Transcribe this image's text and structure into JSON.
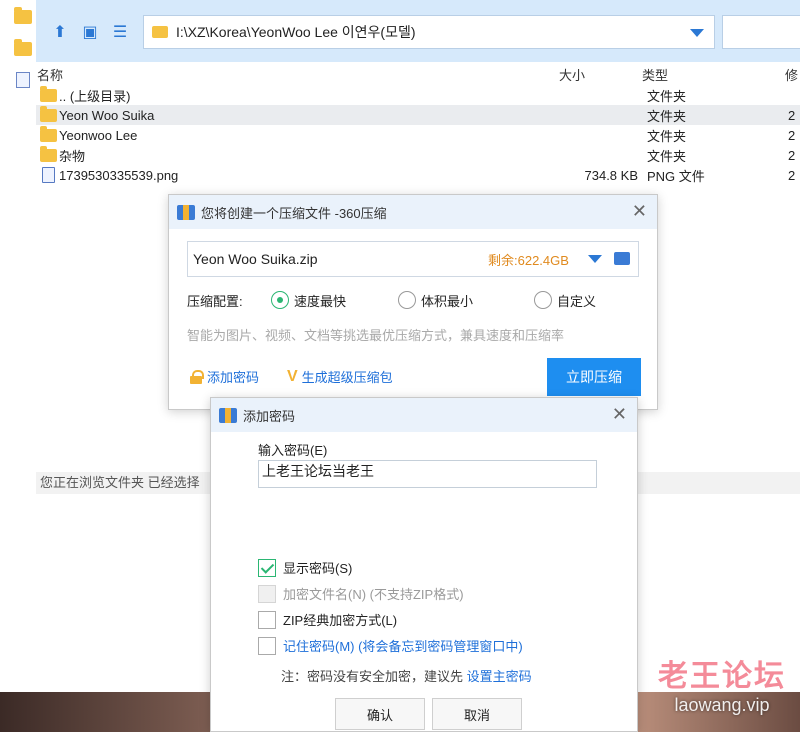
{
  "explorer": {
    "address_path": "I:\\XZ\\Korea\\YeonWoo Lee 이연우(모델)",
    "columns": {
      "name": "名称",
      "size": "大小",
      "type": "类型",
      "modified": "修"
    },
    "rows": [
      {
        "name": ".. (上级目录)",
        "size": "",
        "type": "文件夹",
        "mod": "",
        "icon": "folder-icon"
      },
      {
        "name": "Yeon Woo Suika",
        "size": "",
        "type": "文件夹",
        "mod": "2",
        "icon": "folder-icon",
        "selected": true
      },
      {
        "name": "Yeonwoo Lee",
        "size": "",
        "type": "文件夹",
        "mod": "2",
        "icon": "folder-icon"
      },
      {
        "name": "杂物",
        "size": "",
        "type": "文件夹",
        "mod": "2",
        "icon": "folder-icon"
      },
      {
        "name": "1739530335539.png",
        "size": "734.8 KB",
        "type": "PNG 文件",
        "mod": "2",
        "icon": "png-file-icon"
      }
    ],
    "status": "您正在浏览文件夹 已经选择"
  },
  "compress_dialog": {
    "title": "您将创建一个压缩文件 -360压缩",
    "filename": "Yeon Woo Suika.zip",
    "remaining": "剩余:622.4GB",
    "config_label": "压缩配置:",
    "options": [
      "速度最快",
      "体积最小",
      "自定义"
    ],
    "selected_option": "速度最快",
    "hint": "智能为图片、视频、文档等挑选最优压缩方式，兼具速度和压缩率",
    "add_password": "添加密码",
    "super_pack": "生成超级压缩包",
    "compress_button": "立即压缩"
  },
  "password_dialog": {
    "title": "添加密码",
    "input_label": "输入密码(E)",
    "password_value": "上老王论坛当老王",
    "show_password": "显示密码(S)",
    "encrypt_filename": "加密文件名(N) (不支持ZIP格式)",
    "zip_classic": "ZIP经典加密方式(L)",
    "remember_password": "记住密码(M) (将会备忘到密码管理窗口中)",
    "note_prefix": "注：密码没有安全加密，建议先",
    "note_link": "设置主密码",
    "ok": "确认",
    "cancel": "取消"
  },
  "watermark": {
    "cn": "老王论坛",
    "en": "laowang.vip"
  },
  "colors": {
    "accent": "#1e8ef0",
    "toolbar_bg": "#d6e9fb",
    "check_green": "#2bb673",
    "orange": "#e08a1e"
  }
}
